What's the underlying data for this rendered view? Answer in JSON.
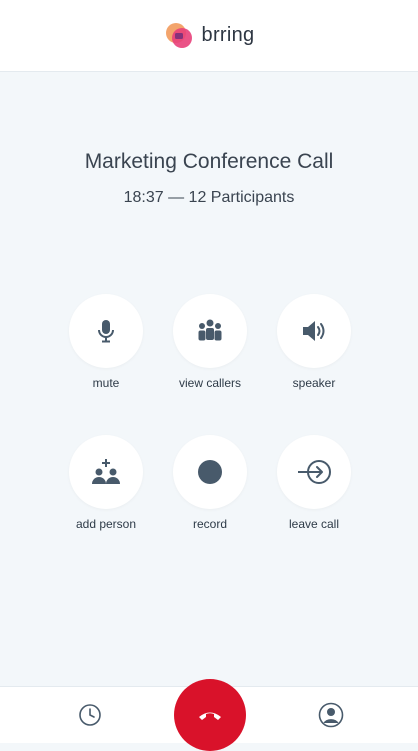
{
  "app": {
    "name": "brring"
  },
  "call": {
    "title": "Marketing Conference Call",
    "subtitle": "18:37 — 12 Participants"
  },
  "actions": [
    {
      "label": "mute",
      "icon": "microphone-icon"
    },
    {
      "label": "view callers",
      "icon": "people-group-icon"
    },
    {
      "label": "speaker",
      "icon": "speaker-icon"
    },
    {
      "label": "add person",
      "icon": "add-person-icon"
    },
    {
      "label": "record",
      "icon": "record-icon"
    },
    {
      "label": "leave call",
      "icon": "leave-call-icon"
    }
  ],
  "bottom_bar": {
    "left_icon": "history-clock-icon",
    "center_icon": "end-call-icon",
    "right_icon": "profile-icon"
  },
  "colors": {
    "background": "#f3f7fa",
    "icon": "#485a6b",
    "end_call": "#d9122a",
    "logo_pink": "#e8407a",
    "logo_orange": "#f29a5c"
  }
}
